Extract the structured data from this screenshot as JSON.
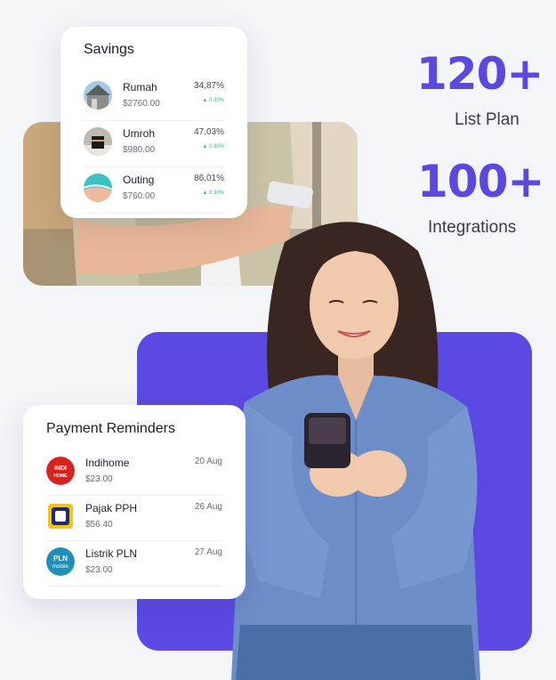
{
  "stats": [
    {
      "value": "120+",
      "label": "List Plan"
    },
    {
      "value": "100+",
      "label": "Integrations"
    }
  ],
  "savings": {
    "title": "Savings",
    "items": [
      {
        "name": "Rumah",
        "amount": "$2760.00",
        "percent": "34,87%",
        "change": "▲ 0.30%"
      },
      {
        "name": "Umroh",
        "amount": "$980.00",
        "percent": "47,03%",
        "change": "▲ 0.30%"
      },
      {
        "name": "Outing",
        "amount": "$760.00",
        "percent": "86,01%",
        "change": "▲ 0.30%"
      }
    ]
  },
  "reminders": {
    "title": "Payment Reminders",
    "items": [
      {
        "name": "Indihome",
        "amount": "$23.00",
        "date": "20 Aug",
        "logo_text": "INDI HOME"
      },
      {
        "name": "Pajak PPH",
        "amount": "$56.40",
        "date": "26 Aug"
      },
      {
        "name": "Listrik PLN",
        "amount": "$23.00",
        "date": "27 Aug",
        "logo_text": "PLN mobile"
      }
    ]
  },
  "colors": {
    "accent": "#5c49e3",
    "positive": "#2bbf7a"
  }
}
